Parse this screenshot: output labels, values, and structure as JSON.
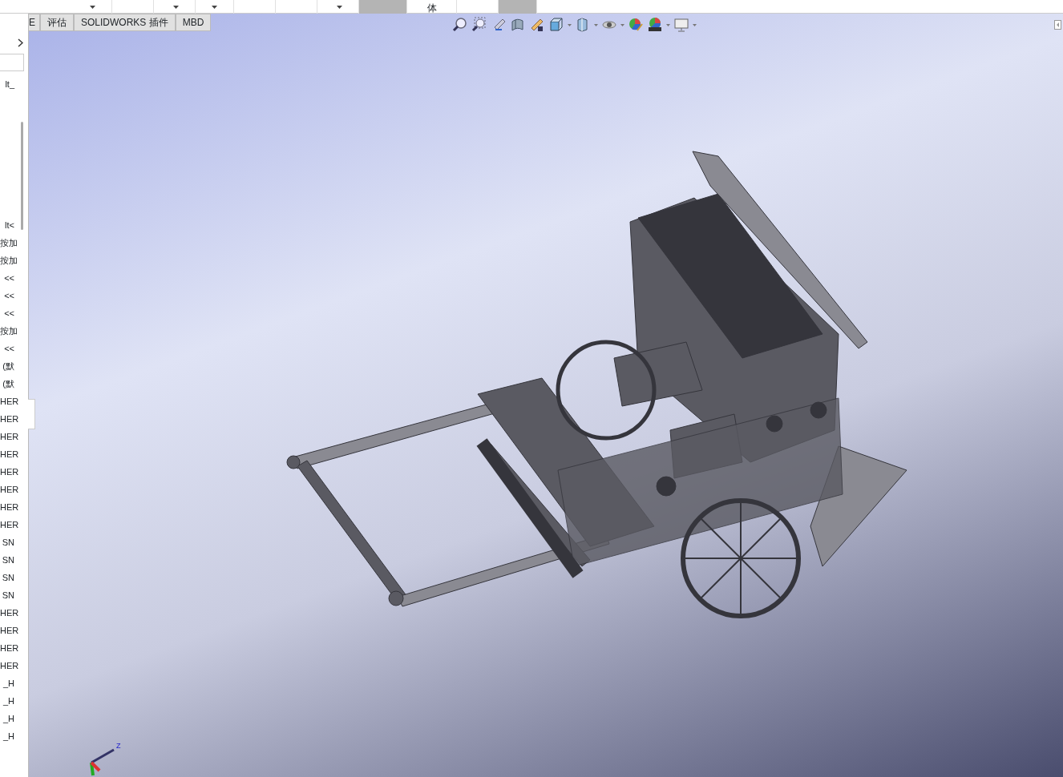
{
  "ribbon": {
    "buttons": [
      {
        "label": "体"
      }
    ]
  },
  "tabs": [
    {
      "label": "E",
      "selected": false
    },
    {
      "label": "评估",
      "selected": false
    },
    {
      "label": "SOLIDWORKS 插件",
      "selected": false
    },
    {
      "label": "MBD",
      "selected": false
    }
  ],
  "feature_tree": {
    "header_items": [
      {
        "label": "lt_"
      }
    ],
    "items": [
      {
        "label": "lt<"
      },
      {
        "label": "按加"
      },
      {
        "label": "按加"
      },
      {
        "label": "<<"
      },
      {
        "label": "<<"
      },
      {
        "label": "<<"
      },
      {
        "label": "按加"
      },
      {
        "label": "<<"
      },
      {
        "label": "(默"
      },
      {
        "label": "(默"
      },
      {
        "label": "HER"
      },
      {
        "label": "HER"
      },
      {
        "label": "HER"
      },
      {
        "label": "HER"
      },
      {
        "label": "HER"
      },
      {
        "label": "HER"
      },
      {
        "label": "HER"
      },
      {
        "label": "HER"
      },
      {
        "label": "SN"
      },
      {
        "label": "SN"
      },
      {
        "label": "SN"
      },
      {
        "label": "SN"
      },
      {
        "label": "HER"
      },
      {
        "label": "HER"
      },
      {
        "label": "HER"
      },
      {
        "label": "HER"
      },
      {
        "label": "_H"
      },
      {
        "label": "_H"
      },
      {
        "label": "_H"
      },
      {
        "label": "_H"
      }
    ]
  },
  "triad": {
    "axes": [
      "Z"
    ]
  }
}
